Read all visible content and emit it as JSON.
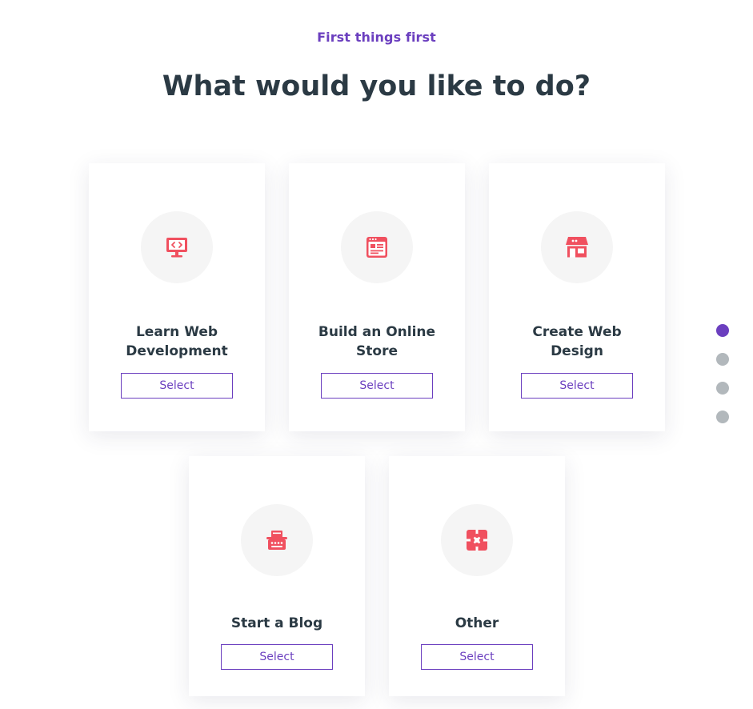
{
  "header": {
    "eyebrow": "First things first",
    "title": "What would you like to do?"
  },
  "cards": [
    {
      "title": "Learn Web Development",
      "icon": "computer-code-icon",
      "button": "Select"
    },
    {
      "title": "Build an Online Store",
      "icon": "online-store-icon",
      "button": "Select"
    },
    {
      "title": "Create Web Design",
      "icon": "storefront-icon",
      "button": "Select"
    },
    {
      "title": "Start a Blog",
      "icon": "typewriter-icon",
      "button": "Select"
    },
    {
      "title": "Other",
      "icon": "puzzle-icon",
      "button": "Select"
    }
  ],
  "pagination": {
    "total": 4,
    "active": 1
  },
  "colors": {
    "accent": "#6b3fbf",
    "icon": "#f0505f",
    "heading": "#2b3a44",
    "dot_inactive": "#b2b8bc",
    "icon_bg": "#f5f5f5"
  }
}
